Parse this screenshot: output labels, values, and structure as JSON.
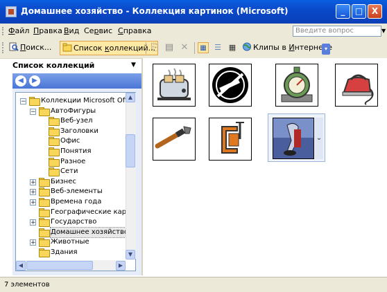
{
  "window": {
    "title": "Домашнее хозяйство - Коллекция картинок (Microsoft)",
    "buttons": [
      "_",
      "□",
      "X"
    ]
  },
  "menu": {
    "items": [
      {
        "pre": "",
        "u": "Ф",
        "post": "айл"
      },
      {
        "pre": "",
        "u": "П",
        "post": "равка"
      },
      {
        "pre": "",
        "u": "В",
        "post": "ид"
      },
      {
        "pre": "Се",
        "u": "р",
        "post": "вис"
      },
      {
        "pre": "",
        "u": "С",
        "post": "правка"
      }
    ],
    "ask_placeholder": "Введите вопрос"
  },
  "toolbar": {
    "search": {
      "pre": "",
      "u": "П",
      "post": "оиск..."
    },
    "collections": {
      "pre": "Список ",
      "u": "к",
      "post": "оллекций..."
    },
    "clips_online": {
      "pre": "Клипы в ",
      "u": "И",
      "post": "нтернете"
    }
  },
  "collection_panel": {
    "title": "Список коллекций",
    "tree": [
      {
        "label": "Коллекции Microsoft Offic",
        "level": 0,
        "expander": "−"
      },
      {
        "label": "АвтоФигуры",
        "level": 1,
        "expander": "−"
      },
      {
        "label": "Веб-узел",
        "level": 2,
        "expander": ""
      },
      {
        "label": "Заголовки",
        "level": 2,
        "expander": ""
      },
      {
        "label": "Офис",
        "level": 2,
        "expander": ""
      },
      {
        "label": "Понятия",
        "level": 2,
        "expander": ""
      },
      {
        "label": "Разное",
        "level": 2,
        "expander": ""
      },
      {
        "label": "Сети",
        "level": 2,
        "expander": ""
      },
      {
        "label": "Бизнес",
        "level": 1,
        "expander": "+"
      },
      {
        "label": "Веб-элементы",
        "level": 1,
        "expander": "+"
      },
      {
        "label": "Времена года",
        "level": 1,
        "expander": "+"
      },
      {
        "label": "Географические карт",
        "level": 1,
        "expander": ""
      },
      {
        "label": "Государство",
        "level": 1,
        "expander": "+"
      },
      {
        "label": "Домашнее хозяйство",
        "level": 1,
        "expander": "",
        "selected": true
      },
      {
        "label": "Животные",
        "level": 1,
        "expander": "+"
      },
      {
        "label": "Здания",
        "level": 1,
        "expander": ""
      }
    ]
  },
  "gallery": {
    "items": [
      {
        "icon": "toaster-icon"
      },
      {
        "icon": "no-smoking-icon"
      },
      {
        "icon": "kitchen-timer-icon"
      },
      {
        "icon": "iron-icon"
      },
      {
        "icon": "wrench-icon"
      },
      {
        "icon": "clamp-icon"
      },
      {
        "icon": "vacuum-cleaner-icon",
        "selected": true
      }
    ]
  },
  "status": {
    "text": "7 элементов"
  }
}
